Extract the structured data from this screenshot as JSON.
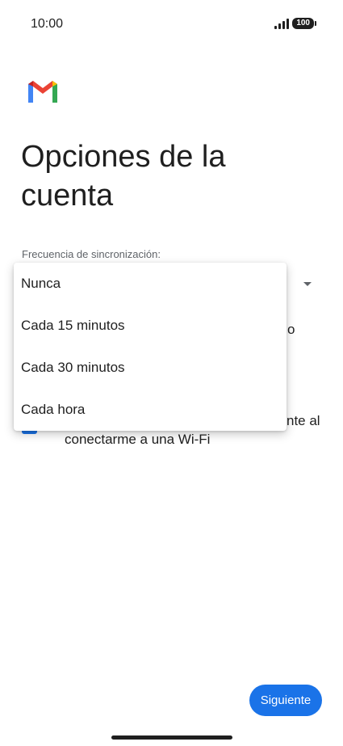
{
  "status_bar": {
    "time": "10:00",
    "battery": "100"
  },
  "header": {
    "title": "Opciones de la cuenta"
  },
  "sync": {
    "label": "Frecuencia de sincronización:",
    "options": [
      "Nunca",
      "Cada 15 minutos",
      "Cada 30 minutos",
      "Cada hora"
    ]
  },
  "background_fragments": {
    "text_1": "o",
    "text_2": "nte al",
    "text_3": "conectarme a una Wi-Fi"
  },
  "footer": {
    "next_label": "Siguiente"
  },
  "colors": {
    "accent": "#1a73e8",
    "text": "#1f1f1f"
  }
}
